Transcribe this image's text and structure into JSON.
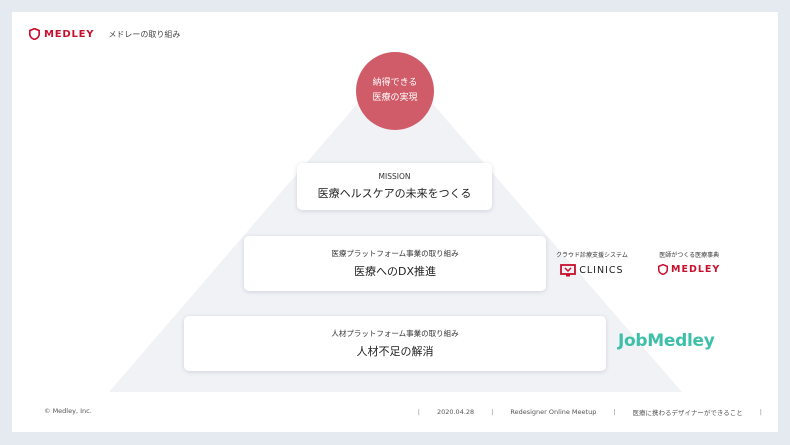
{
  "header": {
    "brand_name": "MEDLEY",
    "title": "メドレーの取り組み"
  },
  "pyramid": {
    "apex_line1": "納得できる",
    "apex_line2": "医療の実現",
    "mission": {
      "sub": "MISSION",
      "main": "医療ヘルスケアの未来をつくる"
    },
    "platform": {
      "sub": "医療プラットフォーム事業の取り組み",
      "main": "医療へのDX推進"
    },
    "hr": {
      "sub": "人材プラットフォーム事業の取り組み",
      "main": "人材不足の解消"
    }
  },
  "services": {
    "clinics": {
      "label": "クラウド診療支援システム",
      "logo_text": "CLINICS"
    },
    "medley": {
      "label": "医師がつくる医療事典",
      "logo_text": "MEDLEY"
    },
    "jobmedley": {
      "logo_text": "JobMedley"
    }
  },
  "footer": {
    "copyright": "© Medley, Inc.",
    "date": "2020.04.28",
    "event": "Redesigner Online Meetup",
    "talk": "医療に携わるデザイナーができること"
  },
  "colors": {
    "brand_red": "#c8102e",
    "apex_red": "#d05c69",
    "pyramid_fill": "#f0f2f6",
    "job_teal": "#3ebfa9",
    "page_bg": "#e5e9f0"
  }
}
